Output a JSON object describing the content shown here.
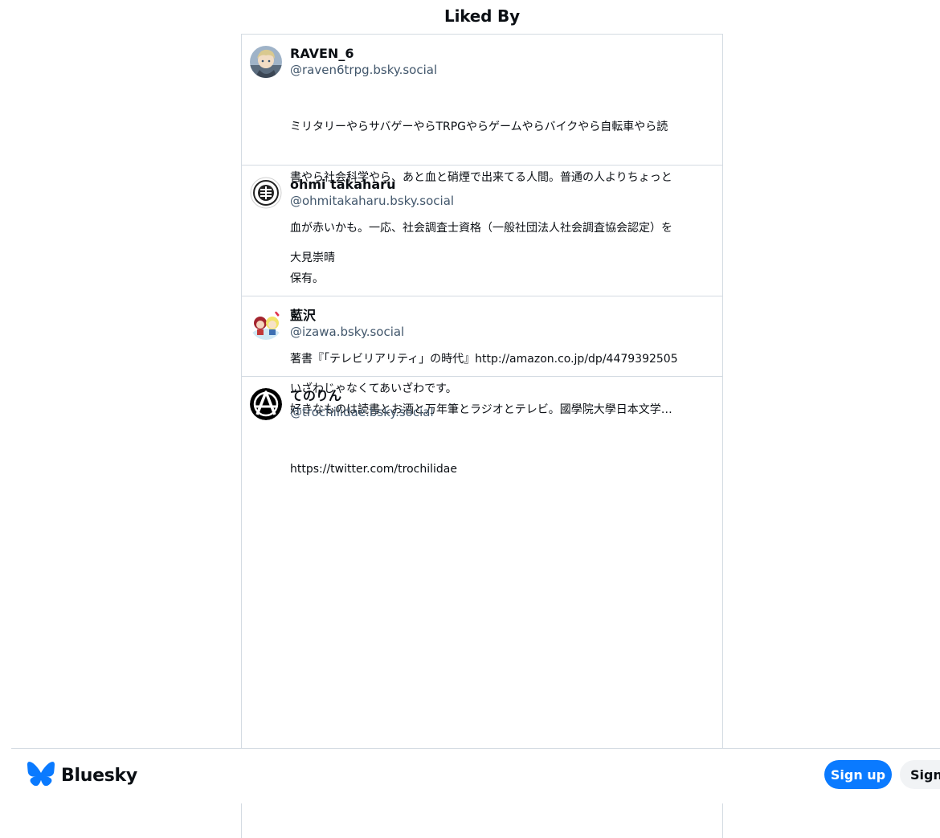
{
  "page": {
    "title": "Liked By"
  },
  "likers": [
    {
      "display_name": "RAVEN_6",
      "handle": "@raven6trpg.bsky.social",
      "bio_lines": [
        "ミリタリーやらサバゲーやらTRPGやらゲームやらバイクやら自転車やら読",
        "書やら社会科学やら、あと血と硝煙で出来てる人間。普通の人よりちょっと",
        "血が赤いかも。一応、社会調査士資格（一般社団法人社会調査協会認定）を",
        "保有。"
      ],
      "avatar_icon": "anime-character-avatar"
    },
    {
      "display_name": "ohmi takaharu",
      "handle": "@ohmitakaharu.bsky.social",
      "bio_lines": [
        "大見崇晴",
        "",
        "著書『「テレビリアリティ」の時代』http://amazon.co.jp/dp/4479392505",
        "好きなものは読書とお酒と万年筆とラジオとテレビ。國學院大學日本文学…"
      ],
      "avatar_icon": "emblem-avatar"
    },
    {
      "display_name": "藍沢",
      "handle": "@izawa.bsky.social",
      "bio_lines": [
        "いざわじゃなくてあいざわです。"
      ],
      "avatar_icon": "two-characters-avatar"
    },
    {
      "display_name": "てのりん",
      "handle": "@trochilidae.bsky.social",
      "bio_lines": [
        "https://twitter.com/trochilidae"
      ],
      "avatar_icon": "anarchy-symbol-avatar"
    }
  ],
  "footer": {
    "brand": "Bluesky",
    "brand_icon": "butterfly-icon",
    "signup_label": "Sign up",
    "signin_label": "Sign in",
    "accent_color": "#0a7aff"
  }
}
